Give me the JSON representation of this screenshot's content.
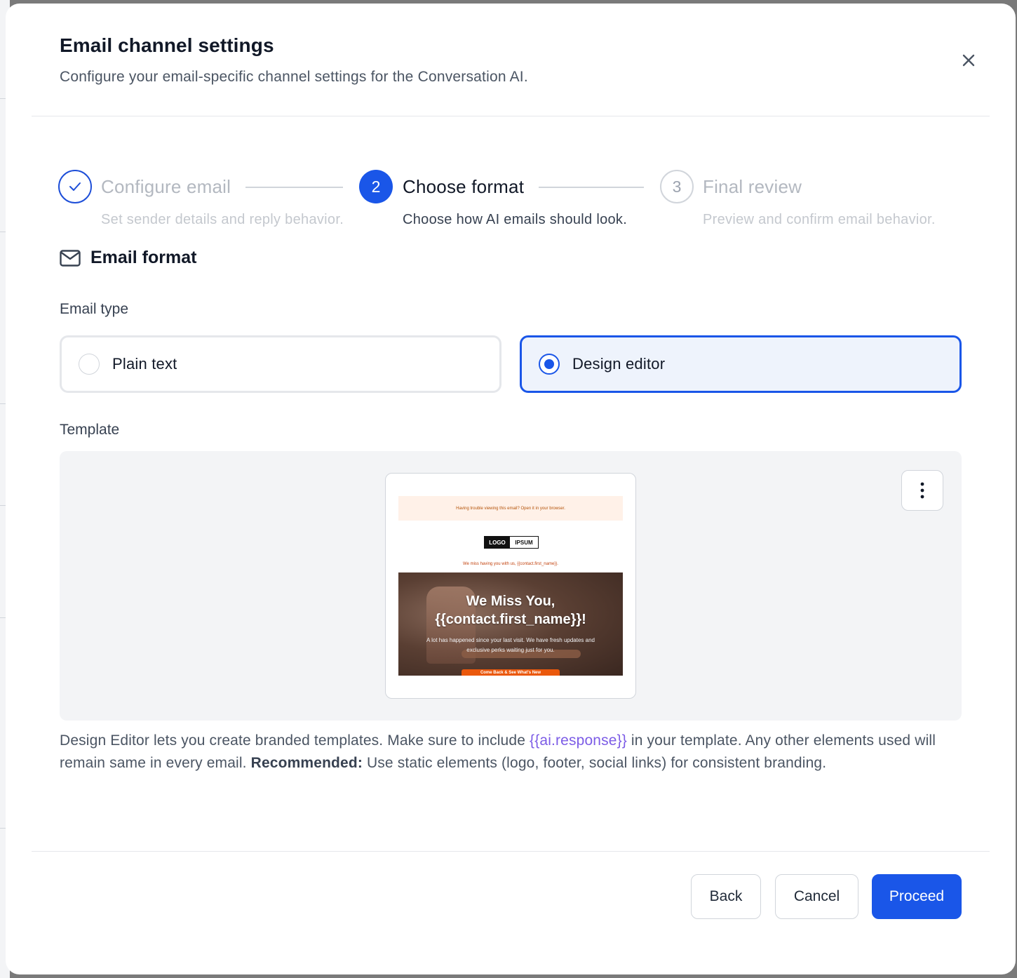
{
  "modal": {
    "title": "Email channel settings",
    "subtitle": "Configure your email-specific channel settings for the Conversation AI."
  },
  "stepper": {
    "steps": [
      {
        "number": "1",
        "label": "Configure email",
        "description": "Set sender details and reply behavior.",
        "state": "completed"
      },
      {
        "number": "2",
        "label": "Choose format",
        "description": "Choose how AI emails should look.",
        "state": "active"
      },
      {
        "number": "3",
        "label": "Final review",
        "description": "Preview and confirm email behavior.",
        "state": "pending"
      }
    ]
  },
  "section": {
    "title": "Email format",
    "icon": "mail-icon"
  },
  "email_type": {
    "label": "Email type",
    "options": [
      {
        "label": "Plain text",
        "selected": false
      },
      {
        "label": "Design editor",
        "selected": true
      }
    ]
  },
  "template": {
    "label": "Template",
    "preview": {
      "top_bar": "Having trouble viewing this email? Open it in your browser.",
      "logo_left": "LOGO",
      "logo_right": "IPSUM",
      "miss_line": "We miss having you with us, {{contact.first_name}}.",
      "headline_1": "We Miss You,",
      "headline_2": "{{contact.first_name}}!",
      "body": "A lot has happened since your last visit. We have fresh updates and exclusive perks waiting just for you.",
      "cta": "Come Back & See What's New"
    }
  },
  "help": {
    "part1": "Design Editor lets you create branded templates. Make sure to include ",
    "variable": "{{ai.response}}",
    "part2": " in your template. Any other elements used will remain same in every email. ",
    "recommended_label": "Recommended:",
    "part3": " Use static elements (logo, footer, social links) for consistent branding."
  },
  "footer": {
    "back": "Back",
    "cancel": "Cancel",
    "proceed": "Proceed"
  },
  "colors": {
    "primary": "#1a56e8",
    "variable": "#7c5ce6"
  }
}
